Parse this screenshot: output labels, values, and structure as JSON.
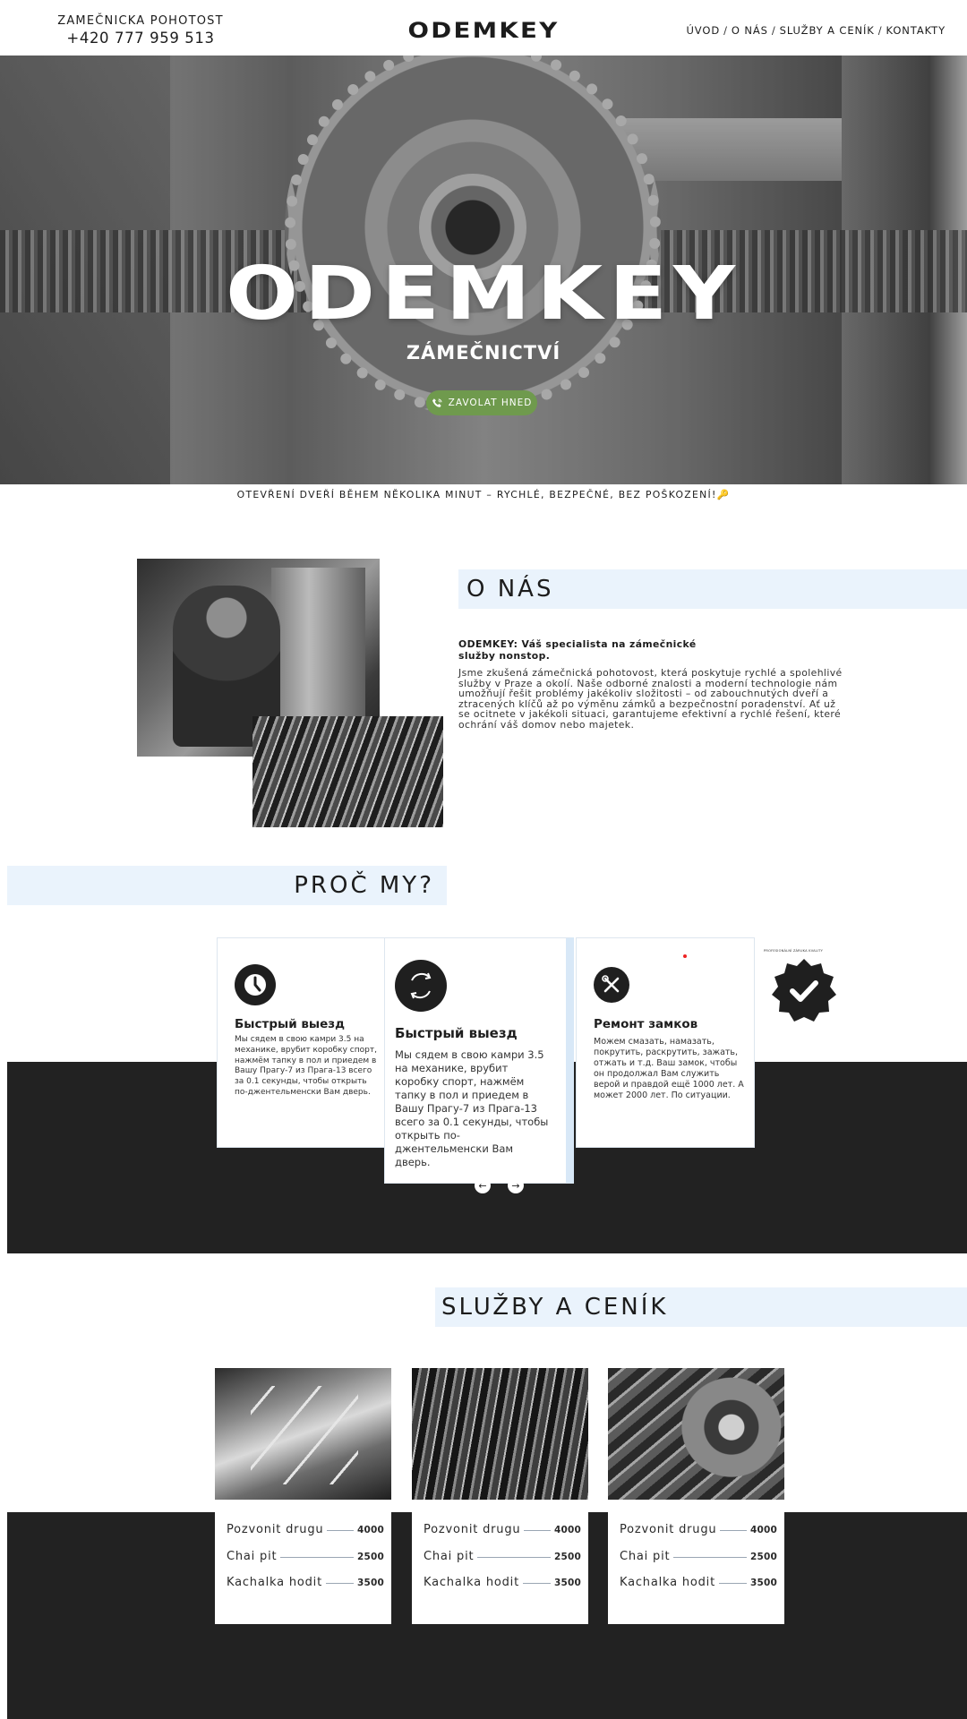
{
  "header": {
    "subtitle": "ZAMEČNICKA POHOTOST",
    "phone": "+420 777 959 513",
    "brand": "ODEMKEY",
    "nav": [
      "ÚVOD",
      "O NÁS",
      "SLUŽBY A CENÍK",
      "KONTAKTY"
    ]
  },
  "hero": {
    "title": "ODEMKEY",
    "subtitle": "ZÁMEČNICTVÍ",
    "cta": "ZAVOLAT HNED",
    "tagline": "OTEVŘENÍ DVEŘÍ BĚHEM NĚKOLIKA MINUT – RYCHLÉ, BEZPEČNÉ, BEZ POŠKOZENÍ!🔑"
  },
  "about": {
    "heading": "O NÁS",
    "lead": "ODEMKEY: Váš specialista na zámečnické služby nonstop.",
    "body": "Jsme zkušená zámečnická pohotovost, která poskytuje rychlé a spolehlivé služby v Praze a okolí. Naše odborné znalosti a moderní technologie nám umožňují řešit problémy jakékoliv složitosti – od zabouchnutých dveří a ztracených klíčů až po výměnu zámků a bezpečnostní poradenství. Ať už se ocitnete v jakékoli situaci, garantujeme efektivní a rychlé řešení, které ochrání váš domov nebo majetek."
  },
  "why": {
    "heading": "PROČ MY?",
    "cards": [
      {
        "icon": "clock-icon",
        "title": "Быстрый выезд",
        "text": "Мы сядем в свою камри 3.5 на механике, врубит коробку спорт, нажмём тапку в пол и приедем в Вашу Прагу-7 из Прага-13 всего за 0.1 секунды, чтобы открыть по-джентельменски Вам дверь."
      },
      {
        "icon": "refresh-icon",
        "title": "Быстрый выезд",
        "text": "Мы сядем в свою камри 3.5 на механике, врубит коробку спорт, нажмём тапку в пол и приедем в Вашу Прагу-7 из Прага-13 всего за 0.1 секунды, чтобы открыть по-джентельменски Вам дверь."
      },
      {
        "icon": "tools-icon",
        "title": "Ремонт замков",
        "text": "Можем смазать, намазать, покрутить, раскрутить, зажать, отжать и т.д. Ваш замок, чтобы он продолжал Вам служить верой и правдой ещё 1000 лет. А может 2000 лет. По ситуации."
      }
    ],
    "badge_caption": "PROFESIONÁLNÍ ZÁRUKA KVALITY",
    "badge_icon": "verified-badge-icon",
    "arrows": [
      "←",
      "→"
    ]
  },
  "services": {
    "heading": "SLUŽBY A CENÍK",
    "cards": [
      {
        "rows": [
          {
            "name": "Pozvonit drugu",
            "price": "4000"
          },
          {
            "name": "Chai pit",
            "price": "2500"
          },
          {
            "name": "Kachalka hodit",
            "price": "3500"
          }
        ]
      },
      {
        "rows": [
          {
            "name": "Pozvonit drugu",
            "price": "4000"
          },
          {
            "name": "Chai pit",
            "price": "2500"
          },
          {
            "name": "Kachalka hodit",
            "price": "3500"
          }
        ]
      },
      {
        "rows": [
          {
            "name": "Pozvonit drugu",
            "price": "4000"
          },
          {
            "name": "Chai pit",
            "price": "2500"
          },
          {
            "name": "Kachalka hodit",
            "price": "3500"
          }
        ]
      }
    ]
  },
  "colors": {
    "accent_green": "#6f9a4d",
    "heading_bg": "#eaf3fc",
    "dark_band": "#222222"
  }
}
